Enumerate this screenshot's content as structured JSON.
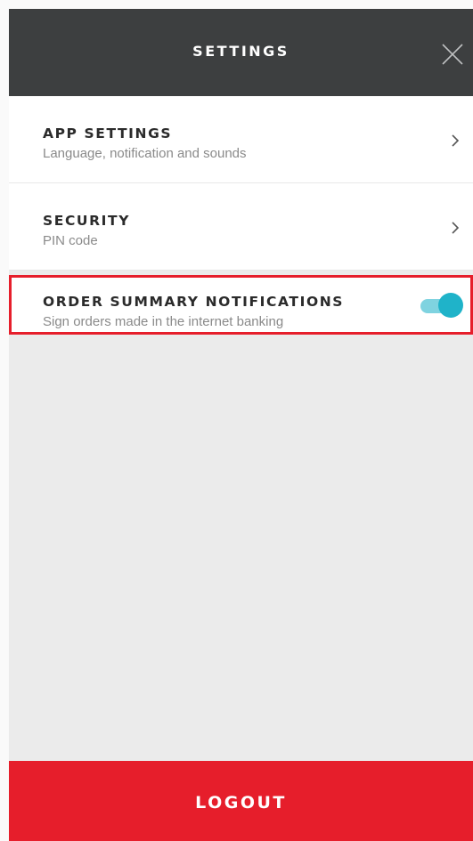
{
  "header": {
    "title": "SETTINGS",
    "close_icon": "close-icon"
  },
  "items": [
    {
      "title": "APP SETTINGS",
      "subtitle": "Language, notification and sounds",
      "control": "chevron-right-icon"
    },
    {
      "title": "SECURITY",
      "subtitle": "PIN code",
      "control": "chevron-right-icon"
    },
    {
      "title": "ORDER SUMMARY NOTIFICATIONS",
      "subtitle": "Sign orders made in the internet banking",
      "control": "toggle",
      "toggle_on": true,
      "highlighted": true
    }
  ],
  "footer": {
    "logout_label": "LOGOUT"
  },
  "colors": {
    "header_bg": "#3d3f40",
    "accent_red": "#e61e2b",
    "toggle_on": "#1fb3c9",
    "toggle_track": "#7fd3e0",
    "content_bg": "#ebebeb"
  }
}
